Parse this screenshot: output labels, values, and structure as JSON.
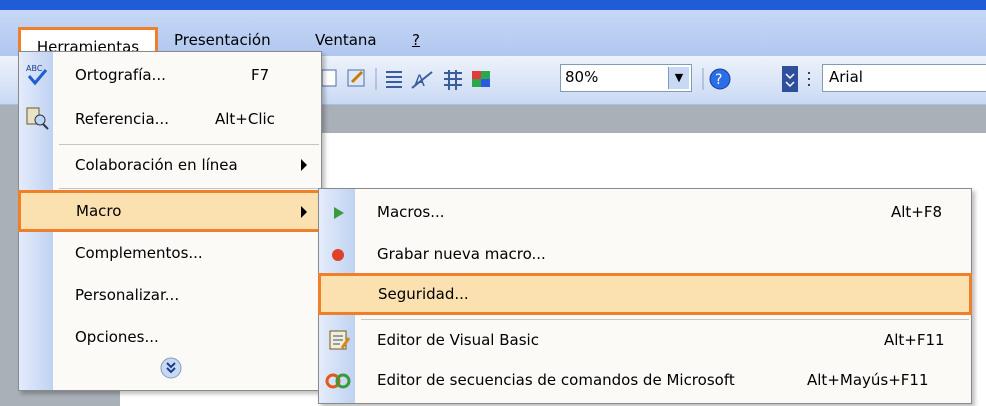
{
  "menubar": {
    "items": [
      {
        "label": "Herramientas"
      },
      {
        "label": "Presentación"
      },
      {
        "label": "Ventana"
      },
      {
        "label": "?"
      }
    ]
  },
  "toolbar": {
    "zoom_value": "80%",
    "font_value": "Arial"
  },
  "tools_menu": {
    "items": [
      {
        "label": "Ortografía...",
        "shortcut": "F7",
        "icon": "spellcheck-icon"
      },
      {
        "label": "Referencia...",
        "shortcut": "Alt+Clic",
        "icon": "research-icon"
      },
      {
        "label": "Colaboración en línea",
        "submenu": true
      },
      {
        "label": "Macro",
        "submenu": true,
        "highlighted": true
      },
      {
        "label": "Complementos..."
      },
      {
        "label": "Personalizar..."
      },
      {
        "label": "Opciones..."
      }
    ],
    "expand_icon": "chevron-double-down-icon"
  },
  "macro_submenu": {
    "items": [
      {
        "label": "Macros...",
        "shortcut": "Alt+F8",
        "icon": "play-icon"
      },
      {
        "label": "Grabar nueva macro...",
        "icon": "record-icon"
      },
      {
        "label": "Seguridad...",
        "highlighted": true
      },
      {
        "label": "Editor de Visual Basic",
        "shortcut": "Alt+F11",
        "icon": "vb-editor-icon"
      },
      {
        "label": "Editor de secuencias de comandos de Microsoft",
        "shortcut": "Alt+Mayús+F11",
        "icon": "script-editor-icon"
      }
    ]
  },
  "colors": {
    "highlight_border": "#f07f2b",
    "highlight_fill": "#fbe0b0",
    "menubar_bg": "#c6d8f6"
  }
}
